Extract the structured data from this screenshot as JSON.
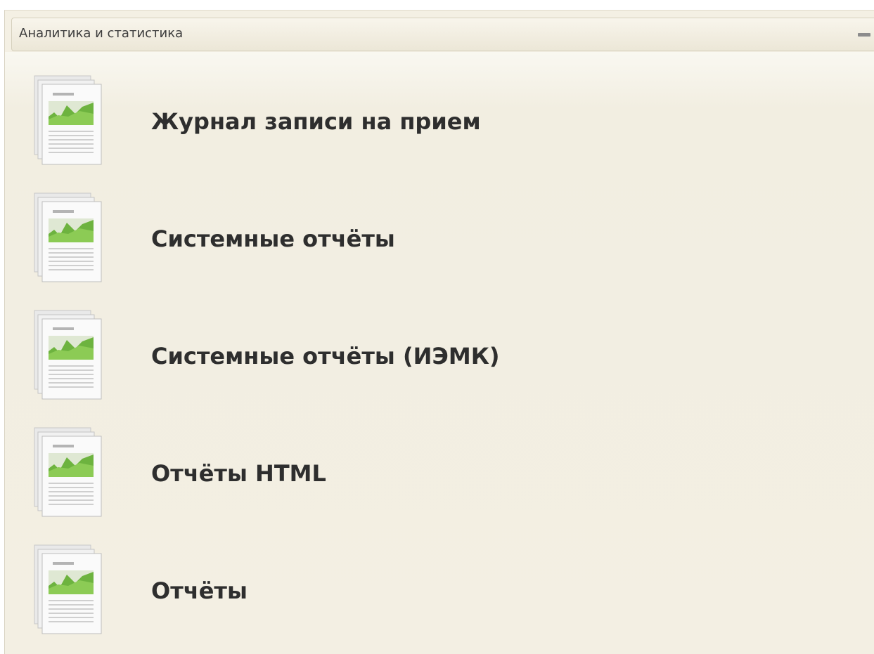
{
  "panel": {
    "title": "Аналитика и статистика",
    "collapse_icon": "minus-icon"
  },
  "items": [
    {
      "label": "Журнал записи на прием",
      "icon": "report-chart-icon"
    },
    {
      "label": "Системные отчёты",
      "icon": "report-chart-icon"
    },
    {
      "label": "Системные отчёты (ИЭМК)",
      "icon": "report-chart-icon"
    },
    {
      "label": "Отчёты HTML",
      "icon": "report-chart-icon"
    },
    {
      "label": "Отчёты",
      "icon": "report-chart-icon"
    }
  ],
  "colors": {
    "panel_background": "#f4f0e4",
    "chart_green": "#6db33f",
    "text": "#2e2e2e"
  }
}
